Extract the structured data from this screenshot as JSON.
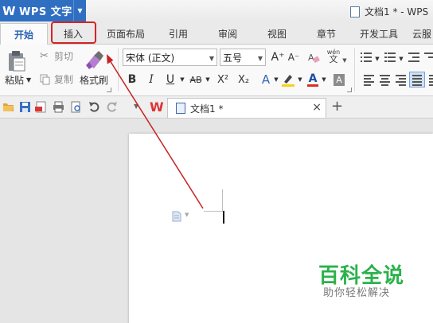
{
  "titlebar": {
    "app_name": "WPS 文字",
    "logo_glyph": "W",
    "document_title": "文档1 * - WPS"
  },
  "tabs": [
    "开始",
    "插入",
    "页面布局",
    "引用",
    "审阅",
    "视图",
    "章节",
    "开发工具",
    "云服"
  ],
  "active_tab": "开始",
  "highlighted_tab": "插入",
  "clipboard": {
    "paste": "粘贴",
    "cut": "剪切",
    "copy": "复制",
    "format_painter": "格式刷"
  },
  "font": {
    "family": "宋体 (正文)",
    "size": "五号"
  },
  "format_buttons": {
    "bold": "B",
    "italic": "I",
    "underline": "U",
    "strikethrough": "AB",
    "superscript": "X²",
    "subscript": "X₂",
    "grow": "A⁺",
    "shrink": "A⁻",
    "pinyin_top": "wén",
    "pinyin_bottom": "文"
  },
  "document_tab": {
    "label": "文档1 *",
    "close": "×",
    "new_tab": "+"
  },
  "watermark": {
    "title": "百科全说",
    "subtitle": "助你轻松解决"
  },
  "colors": {
    "app_blue": "#2f6fc2",
    "highlight_red": "#d42424",
    "watermark_green": "#2bb24c",
    "font_color_red": "#d93025",
    "highlight_yellow": "#f5d31a"
  }
}
